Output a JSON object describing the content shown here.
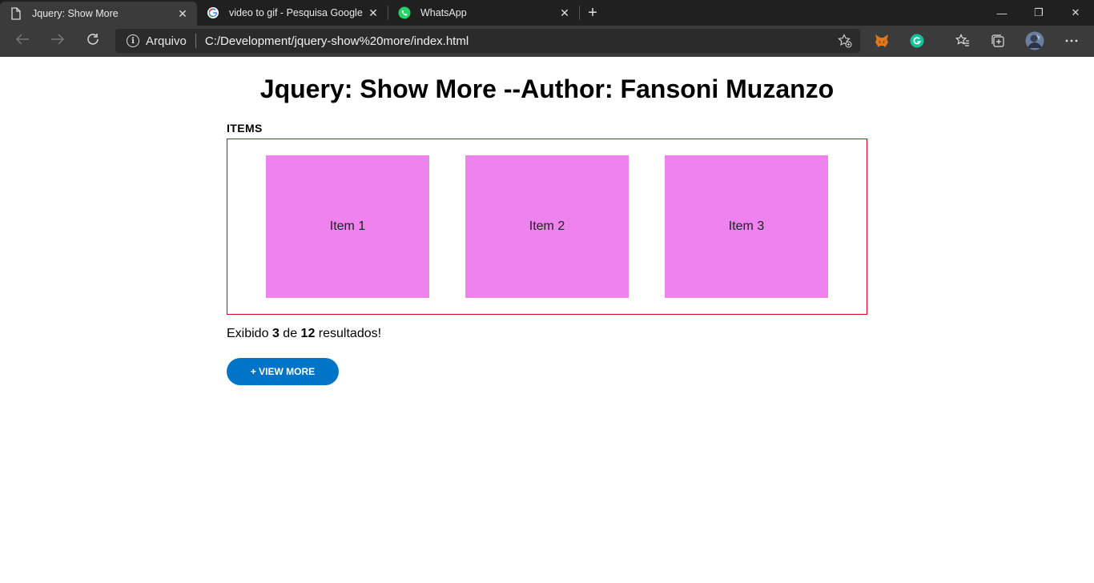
{
  "browser": {
    "tabs": [
      {
        "title": "Jquery: Show More",
        "icon": "document-icon",
        "active": true
      },
      {
        "title": "video to gif - Pesquisa Google",
        "icon": "google-icon",
        "active": false
      },
      {
        "title": "WhatsApp",
        "icon": "whatsapp-icon",
        "active": false
      }
    ],
    "close_glyph": "✕",
    "new_tab_glyph": "+",
    "window_controls": {
      "minimize": "—",
      "restore": "❐",
      "close": "✕"
    },
    "address": {
      "scheme_label": "Arquivo",
      "url": "C:/Development/jquery-show%20more/index.html"
    },
    "extensions": [
      "metamask-icon",
      "grammarly-icon"
    ],
    "toolbar_icons": [
      "favorites-icon",
      "collections-icon",
      "profile-avatar",
      "more-menu-icon"
    ]
  },
  "page": {
    "heading": "Jquery: Show More --Author: Fansoni Muzanzo",
    "section_label": "ITEMS",
    "items": [
      "Item 1",
      "Item 2",
      "Item 3"
    ],
    "results": {
      "prefix": "Exibido",
      "shown": "3",
      "middle": "de",
      "total": "12",
      "suffix": "resultados!"
    },
    "view_more_label": "+ VIEW MORE"
  },
  "colors": {
    "item_fill": "#ee82ee",
    "box_border": "#d9001b",
    "button_bg": "#0074c7"
  }
}
